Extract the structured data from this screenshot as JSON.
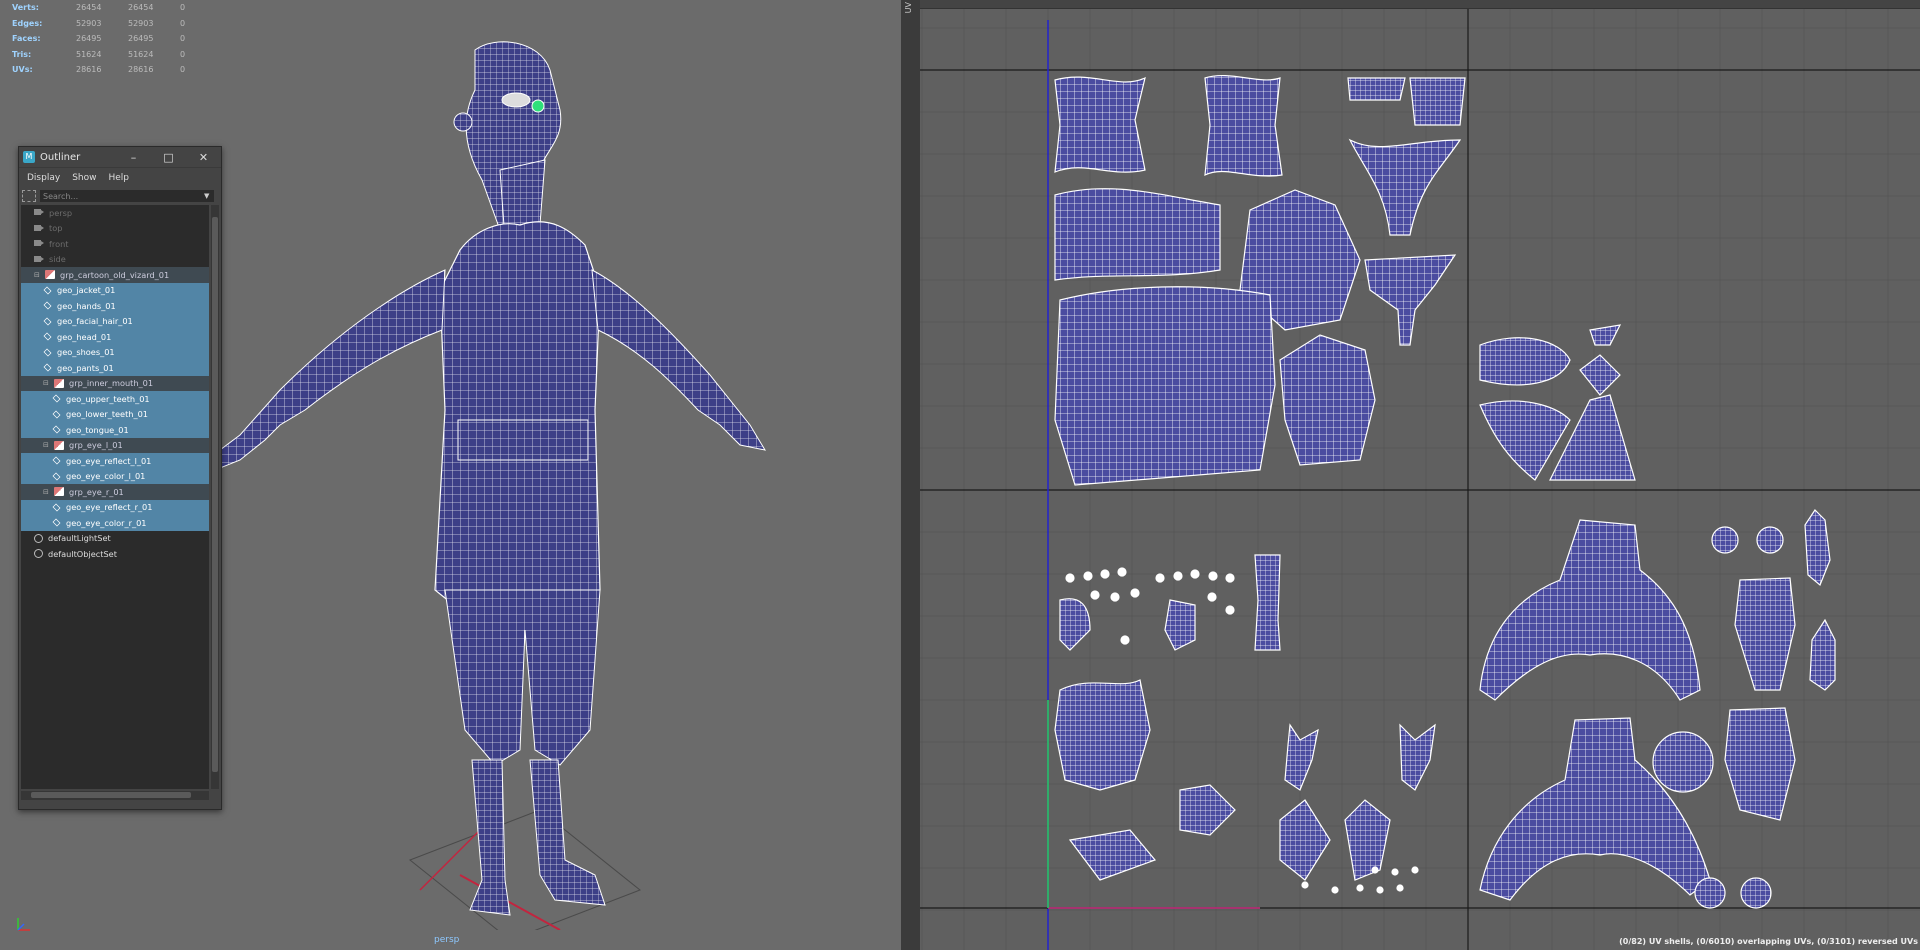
{
  "hud": {
    "rows": [
      {
        "label": "Verts:",
        "v1": "26454",
        "v2": "26454",
        "v3": "0"
      },
      {
        "label": "Edges:",
        "v1": "52903",
        "v2": "52903",
        "v3": "0"
      },
      {
        "label": "Faces:",
        "v1": "26495",
        "v2": "26495",
        "v3": "0"
      },
      {
        "label": "Tris:",
        "v1": "51624",
        "v2": "51624",
        "v3": "0"
      },
      {
        "label": "UVs:",
        "v1": "28616",
        "v2": "28616",
        "v3": "0"
      }
    ]
  },
  "viewport": {
    "camera_label": "persp",
    "wire_color": "#ffffff",
    "mesh_color": "#3d3f87",
    "grid_red": "#c2253f"
  },
  "outliner": {
    "title": "Outliner",
    "menu": [
      "Display",
      "Show",
      "Help"
    ],
    "search_placeholder": "Search...",
    "items": [
      {
        "label": "persp",
        "icon": "camera-icon",
        "state": "dim"
      },
      {
        "label": "top",
        "icon": "camera-icon",
        "state": "dim"
      },
      {
        "label": "front",
        "icon": "camera-icon",
        "state": "dim"
      },
      {
        "label": "side",
        "icon": "camera-icon",
        "state": "dim"
      },
      {
        "label": "grp_cartoon_old_vizard_01",
        "icon": "group-icon",
        "state": "group"
      },
      {
        "label": "geo_jacket_01",
        "icon": "mesh-icon",
        "state": "selected"
      },
      {
        "label": "geo_hands_01",
        "icon": "mesh-icon",
        "state": "selected"
      },
      {
        "label": "geo_facial_hair_01",
        "icon": "mesh-icon",
        "state": "selected"
      },
      {
        "label": "geo_head_01",
        "icon": "mesh-icon",
        "state": "selected"
      },
      {
        "label": "geo_shoes_01",
        "icon": "mesh-icon",
        "state": "selected"
      },
      {
        "label": "geo_pants_01",
        "icon": "mesh-icon",
        "state": "selected"
      },
      {
        "label": "grp_inner_mouth_01",
        "icon": "group-icon",
        "state": "group"
      },
      {
        "label": "geo_upper_teeth_01",
        "icon": "mesh-icon",
        "state": "selected"
      },
      {
        "label": "geo_lower_teeth_01",
        "icon": "mesh-icon",
        "state": "selected"
      },
      {
        "label": "geo_tongue_01",
        "icon": "mesh-icon",
        "state": "selected"
      },
      {
        "label": "grp_eye_l_01",
        "icon": "group-icon",
        "state": "group"
      },
      {
        "label": "geo_eye_reflect_l_01",
        "icon": "mesh-icon",
        "state": "selected"
      },
      {
        "label": "geo_eye_color_l_01",
        "icon": "mesh-icon",
        "state": "selected"
      },
      {
        "label": "grp_eye_r_01",
        "icon": "group-icon",
        "state": "group"
      },
      {
        "label": "geo_eye_reflect_r_01",
        "icon": "mesh-icon",
        "state": "selected"
      },
      {
        "label": "geo_eye_color_r_01",
        "icon": "mesh-icon",
        "state": "selected"
      },
      {
        "label": "defaultLightSet",
        "icon": "set-icon",
        "state": "normal"
      },
      {
        "label": "defaultObjectSet",
        "icon": "set-icon",
        "state": "normal"
      }
    ],
    "indent": [
      1,
      1,
      1,
      1,
      1,
      2,
      2,
      2,
      2,
      2,
      2,
      2,
      3,
      3,
      3,
      2,
      3,
      3,
      2,
      3,
      3,
      1,
      1
    ]
  },
  "uv_editor": {
    "tab_label": "UV",
    "status": "(0/82) UV shells, (0/6010) overlapping UVs, (0/3101) reversed UVs",
    "shell_color": "#4b4ca0",
    "axis_u_color": "#c42a7a",
    "axis_v_color": "#2222cc",
    "grid_lines": "#535353"
  }
}
